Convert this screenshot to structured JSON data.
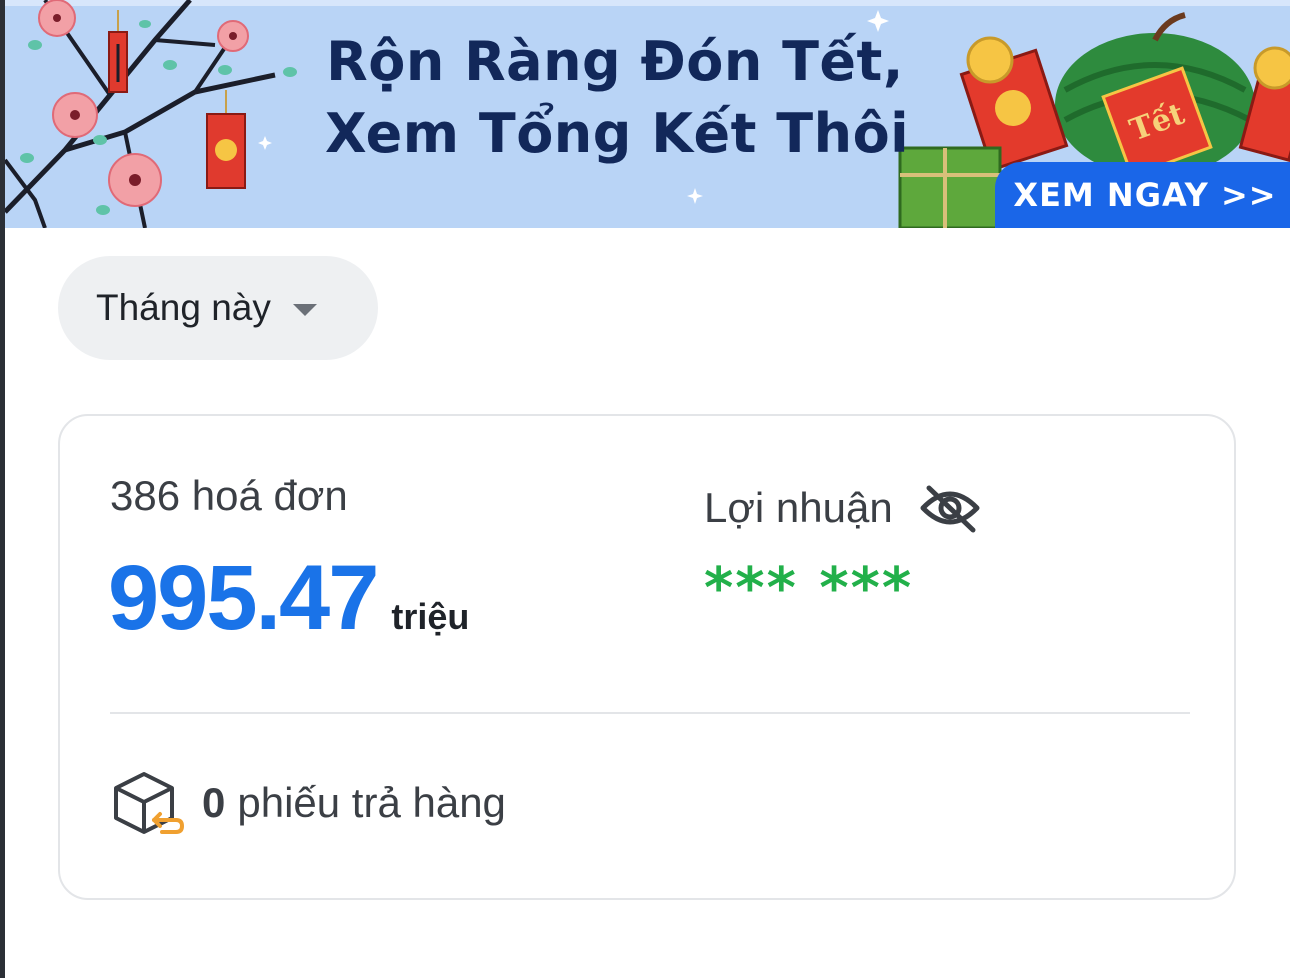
{
  "banner": {
    "title_line1": "Rộn Ràng Đón Tết,",
    "title_line2": "Xem Tổng Kết Thôi",
    "cta_label": "XEM NGAY >>",
    "envelope_text": "Tết",
    "background_color": "#b9d4f6",
    "cta_color": "#1a66e8"
  },
  "filter": {
    "period_label": "Tháng này",
    "caret_icon": "caret-down-icon"
  },
  "summary": {
    "invoice_count_label": "386 hoá đơn",
    "revenue_value": "995.47",
    "revenue_unit": "triệu",
    "revenue_color": "#1a73e8",
    "profit_label": "Lợi nhuận",
    "profit_visibility_icon": "eye-off-icon",
    "profit_masked_value": "*** ***",
    "profit_color": "#22b04a",
    "returns_icon": "box-return-icon",
    "returns_count": "0",
    "returns_label": "phiếu trả hàng"
  }
}
